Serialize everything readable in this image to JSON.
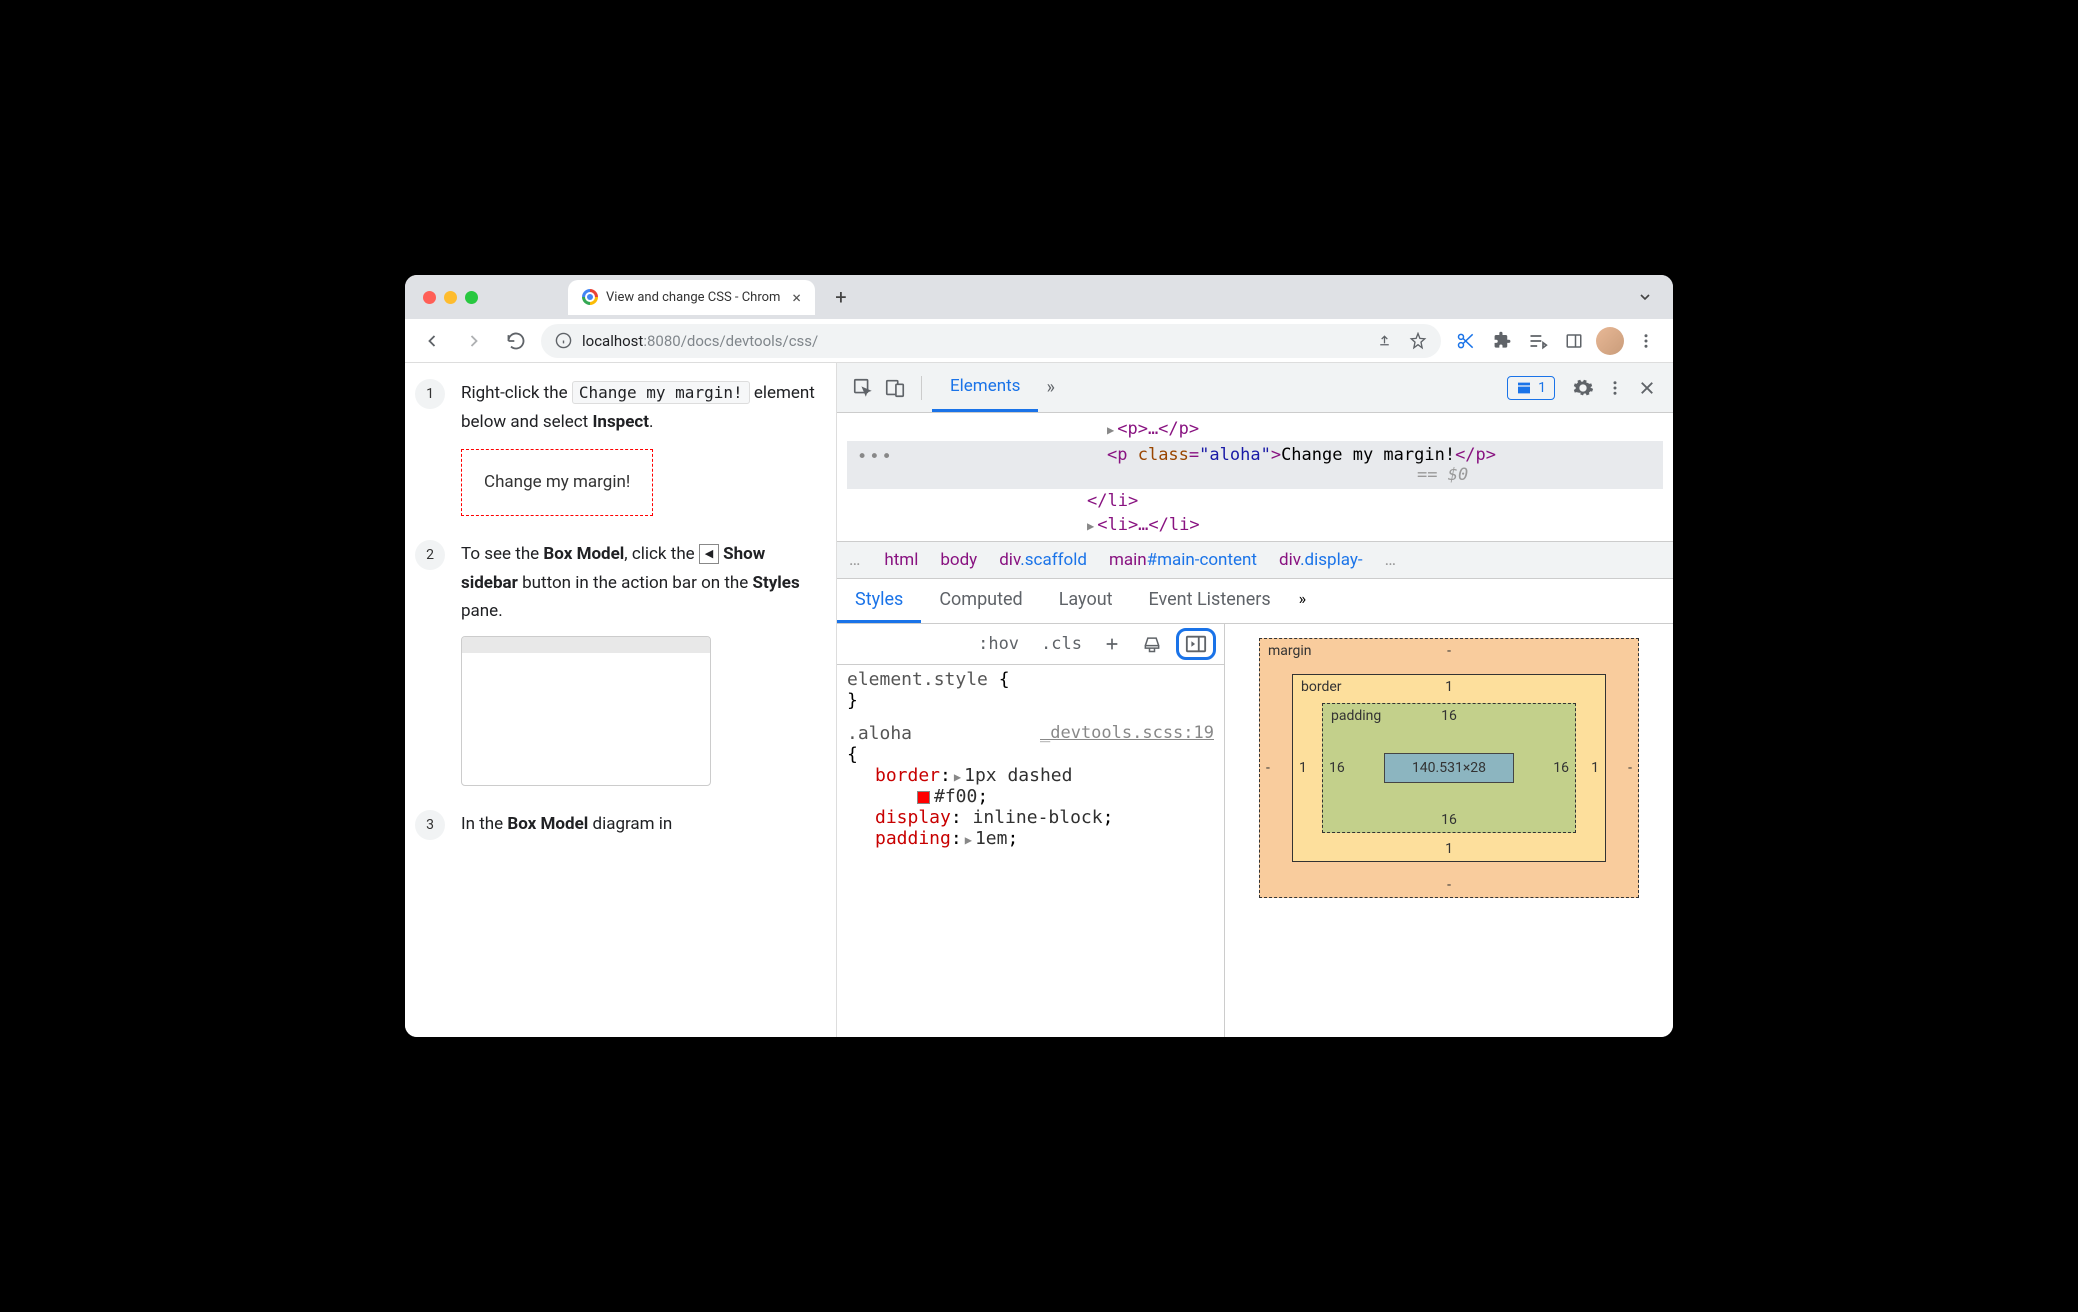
{
  "browser": {
    "tab_title": "View and change CSS - Chrom",
    "url_info_label": "localhost",
    "url_port": ":8080",
    "url_path": "/docs/devtools/css/"
  },
  "page": {
    "step1_num": "1",
    "step1_a": "Right-click the ",
    "step1_code": "Change my margin!",
    "step1_b": " element below and select ",
    "step1_inspect": "Inspect",
    "step1_c": ".",
    "demo_text": "Change my margin!",
    "step2_num": "2",
    "step2_a": "To see the ",
    "step2_boxmodel": "Box Model",
    "step2_b": ", click the ",
    "step2_showsidebar": "Show sidebar",
    "step2_c": " button in the action bar on the ",
    "step2_styles": "Styles",
    "step2_d": " pane.",
    "step3_num": "3",
    "step3_a": "In the ",
    "step3_boxmodel": "Box Model",
    "step3_b": " diagram in"
  },
  "dt": {
    "tab_elements": "Elements",
    "issues_count": "1",
    "dom": {
      "l1_pre": "▶",
      "l1": "<p>…</p>",
      "sel_open": "<p ",
      "sel_attr_name": "class",
      "sel_attr_eq": "=",
      "sel_attr_val": "\"aloha\"",
      "sel_close": ">",
      "sel_text": "Change my margin!",
      "sel_endtag": "</p>",
      "eq0": "== $0",
      "li_close": "</li>",
      "li2_pre": "▶",
      "li2": "<li>…</li>"
    },
    "crumbs": {
      "ell_l": "…",
      "html": "html",
      "body": "body",
      "div_pre": "div",
      "div_cls": ".scaffold",
      "main_pre": "main",
      "main_id": "#main-content",
      "div2_pre": "div",
      "div2_cls": ".display-",
      "ell_r": "…"
    },
    "styles_tabs": {
      "styles": "Styles",
      "computed": "Computed",
      "layout": "Layout",
      "event": "Event Listeners"
    },
    "filter": {
      "hov": ":hov",
      "cls": ".cls"
    },
    "rules": {
      "element_style_sel": "element.style",
      "brace_open": " {",
      "brace_close": "}",
      "aloha_sel": ".aloha",
      "aloha_src": "_devtools.scss:19",
      "border_name": "border",
      "border_val_pre": "1px dashed",
      "border_val_color": "#f00",
      "display_name": "display",
      "display_val": "inline-block",
      "padding_name": "padding",
      "padding_val": "1em"
    },
    "boxmodel": {
      "margin_lbl": "margin",
      "border_lbl": "border",
      "padding_lbl": "padding",
      "content": "140.531×28",
      "pad_t": "16",
      "pad_r": "16",
      "pad_b": "16",
      "pad_l": "16",
      "bor_t": "1",
      "bor_r": "1",
      "bor_b": "1",
      "bor_l": "1",
      "mar_t": "-",
      "mar_r": "-",
      "mar_b": "-",
      "mar_l": "-"
    }
  }
}
